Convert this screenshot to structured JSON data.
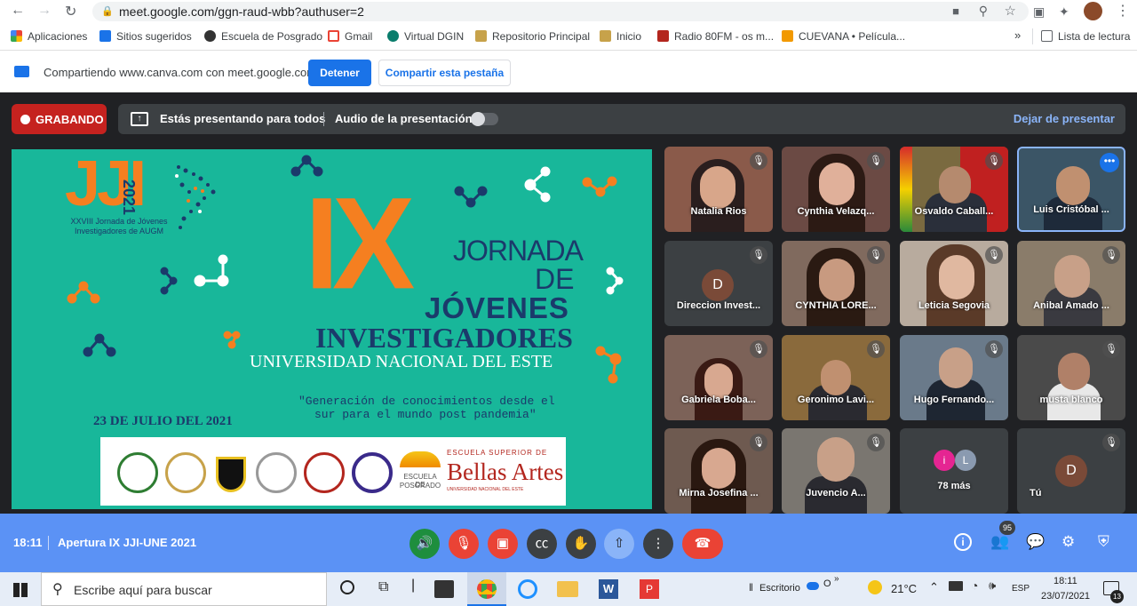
{
  "browser": {
    "url": "meet.google.com/ggn-raud-wbb?authuser=2"
  },
  "bookmarks": [
    {
      "label": "Aplicaciones",
      "color": "#ea4335"
    },
    {
      "label": "Sitios sugeridos",
      "color": "#1a73e8"
    },
    {
      "label": "Escuela de Posgrado",
      "color": "#333333"
    },
    {
      "label": "Gmail",
      "color": "#ea4335"
    },
    {
      "label": "Virtual DGIN",
      "color": "#0a7d6c"
    },
    {
      "label": "Repositorio Principal",
      "color": "#c7a24a"
    },
    {
      "label": "Inicio",
      "color": "#c7a24a"
    },
    {
      "label": "Radio 80FM - os m...",
      "color": "#b3261e"
    },
    {
      "label": "CUEVANA • Película...",
      "color": "#f29900"
    }
  ],
  "bookmarks_more": "»",
  "reading_list": "Lista de lectura",
  "share": {
    "text": "Compartiendo www.canva.com con meet.google.com",
    "stop": "Detener",
    "share_tab": "Compartir esta pestaña"
  },
  "meet": {
    "recording": "GRABANDO",
    "presenting": "Estás presentando para todos",
    "audio": "Audio de la presentación",
    "stop_presenting": "Dejar de presentar",
    "time": "18:11",
    "meeting_title": "Apertura IX JJI-UNE 2021",
    "participants_count": "95"
  },
  "slide": {
    "logo": "JJI",
    "logo_year": "2021",
    "logo_sub1": "XXVIII Jornada de Jóvenes",
    "logo_sub2": "Investigadores de AUGM",
    "numeral": "IX",
    "line1": "JORNADA",
    "line2": "DE",
    "line3": "JÓVENES",
    "line4": "INVESTIGADORES",
    "university": "UNIVERSIDAD NACIONAL DEL ESTE",
    "quote1": "\"Generación de conocimientos desde el",
    "quote2": "sur para el mundo post pandemia\"",
    "date": "23 DE JULIO DEL 2021",
    "posgrado1": "ESCUELA DE",
    "posgrado2": "POSGRADO",
    "bellas1": "ESCUELA SUPERIOR DE",
    "bellas2": "Bellas Artes",
    "bellas3": "UNIVERSIDAD NACIONAL DEL ESTE"
  },
  "participants": [
    {
      "name": "Natalia Rios",
      "bg": "#8a5a4a"
    },
    {
      "name": "Cynthia Velazq...",
      "bg": "#6b4a44"
    },
    {
      "name": "Osvaldo Caball...",
      "bg": "#7a6a40"
    },
    {
      "name": "Luis Cristóbal ...",
      "bg": "#3b5566"
    },
    {
      "name": "Direccion Invest...",
      "bg": "#3c4043",
      "initial": "D"
    },
    {
      "name": "CYNTHIA LORE...",
      "bg": "#806a5e"
    },
    {
      "name": "Leticia Segovia",
      "bg": "#b8ab9e"
    },
    {
      "name": "Anibal Amado ...",
      "bg": "#8a7c6a"
    },
    {
      "name": "Gabriela Boba...",
      "bg": "#7c6258"
    },
    {
      "name": "Geronimo Lavi...",
      "bg": "#8a6a3c"
    },
    {
      "name": "Hugo Fernando...",
      "bg": "#6a7a8a"
    },
    {
      "name": "musta blanco",
      "bg": "#4a4a4a"
    },
    {
      "name": "Mirna Josefina ...",
      "bg": "#6e5a50"
    },
    {
      "name": "Juvencio A...",
      "bg": "#7a7670"
    },
    {
      "name": "78 más",
      "bg": "#3c4043"
    },
    {
      "name": "Tú",
      "bg": "#3c4043",
      "initial": "D"
    }
  ],
  "more_avatars": [
    "i",
    "L"
  ],
  "taskbar": {
    "search": "Escribe aquí para buscar",
    "desktop": "Escritorio",
    "weather_icon": "sun-cloud",
    "temp": "21°C",
    "lang": "ESP",
    "time": "18:11",
    "date": "23/07/2021",
    "notif_count": "13",
    "cloud_o": "O"
  }
}
